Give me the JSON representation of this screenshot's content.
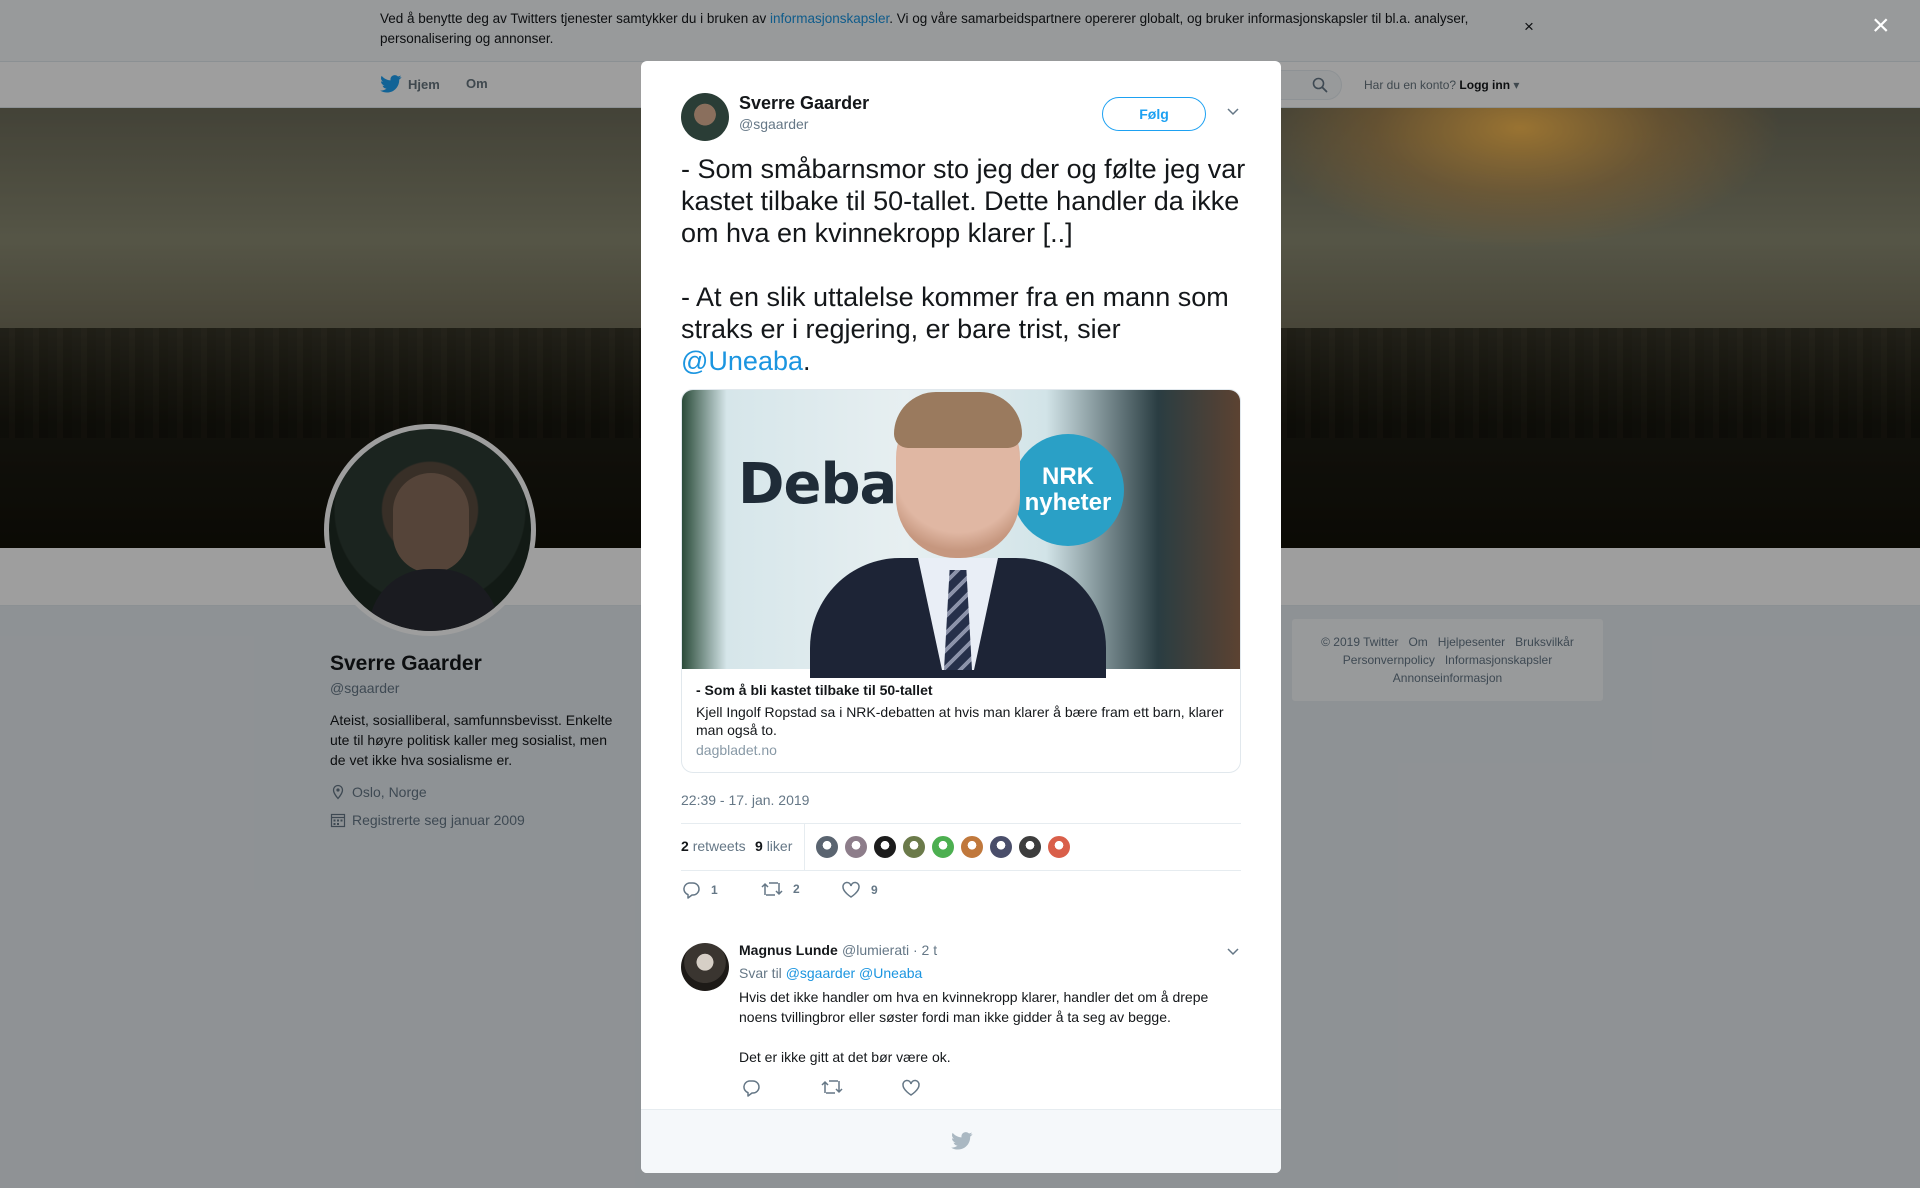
{
  "cookie_banner": {
    "text_before": "Ved å benytte deg av Twitters tjenester samtykker du i bruken av ",
    "link": "informasjonskapsler",
    "text_after": ". Vi og våre samarbeidspartnere opererer globalt, og bruker informasjonskapsler til bl.a. analyser, personalisering og annonser.",
    "close": "×"
  },
  "nav": {
    "home": "Hjem",
    "about": "Om",
    "have_account": "Har du en konto?",
    "login": "Logg inn"
  },
  "profile": {
    "name": "Sverre Gaarder",
    "handle": "@sgaarder",
    "bio": "Ateist, sosialliberal, samfunnsbevisst. Enkelte ute til høyre politisk kaller meg sosialist, men de vet ikke hva sosialisme er.",
    "location": "Oslo, Norge",
    "joined": "Registrerte seg januar 2009"
  },
  "footer": {
    "links_row1": [
      "© 2019 Twitter",
      "Om",
      "Hjelpesenter",
      "Bruksvilkår"
    ],
    "links_row2": [
      "Personvernpolicy",
      "Informasjonskapsler"
    ],
    "links_row3": [
      "Annonseinformasjon"
    ]
  },
  "overlay_close": "×",
  "tweet": {
    "author_name": "Sverre Gaarder",
    "author_handle": "@sgaarder",
    "follow_label": "Følg",
    "text": "- Som småbarnsmor sto jeg der og følte jeg var kastet tilbake til 50-tallet. Dette handler da ikke om hva en kvinnekropp klarer [..]\n\n- At en slik uttalelse kommer fra en mann som straks er i regjering, er bare trist, sier ",
    "mention": "@Uneaba",
    "text_end": ".",
    "card": {
      "image_text_debate": "Debat",
      "image_text_nrk": "NRK\nnyheter",
      "title": "- Som å bli kastet tilbake til 50-tallet",
      "description": "Kjell Ingolf Ropstad sa i NRK-debatten at hvis man klarer å bære fram ett barn, klarer man også to.",
      "domain": "dagbladet.no"
    },
    "timestamp": "22:39 - 17. jan. 2019",
    "retweets_count": "2",
    "retweets_label": "retweets",
    "likes_count": "9",
    "likes_label": "liker",
    "liker_colors": [
      "#5a6470",
      "#8d7d8a",
      "#1c1c1c",
      "#6b7a4a",
      "#4caf50",
      "#c0783c",
      "#4a4e6a",
      "#3d3d3d",
      "#d95f4a"
    ],
    "action_counts": {
      "replies": "1",
      "retweets": "2",
      "likes": "9"
    }
  },
  "reply": {
    "name": "Magnus Lunde",
    "handle": "@lumierati · 2 t",
    "reply_to_label": "Svar til",
    "reply_to_mentions": "@sgaarder @Uneaba",
    "text": "Hvis det ikke handler om hva en kvinnekropp klarer, handler det om å drepe noens tvillingbror eller søster fordi man ikke gidder å ta seg av begge.\n\nDet er ikke gitt at det bør være ok."
  },
  "colors": {
    "accent": "#1da1f2",
    "link": "#1b95e0",
    "muted": "#657786",
    "text": "#14171a"
  }
}
